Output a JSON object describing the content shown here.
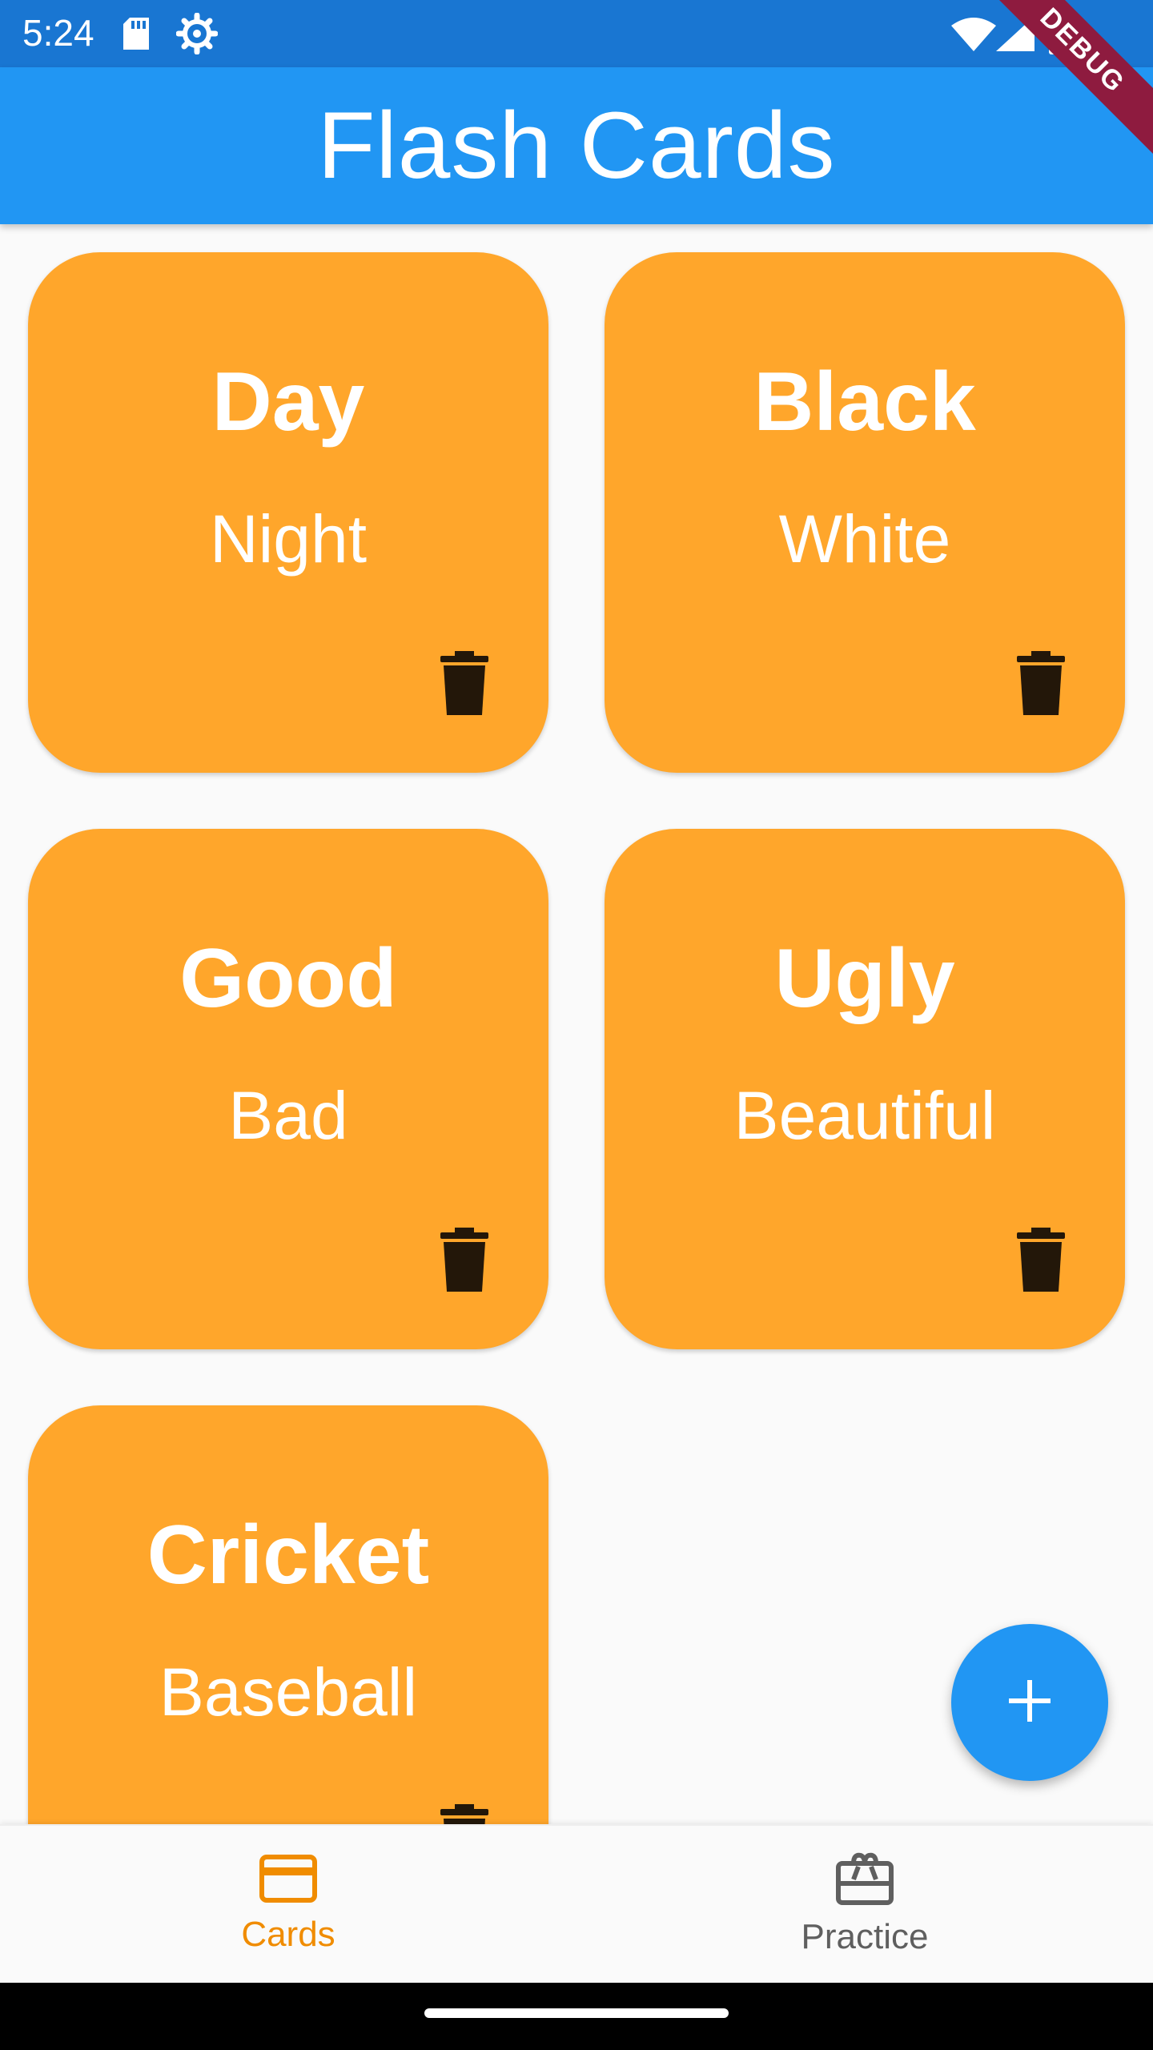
{
  "status_bar": {
    "time": "5:24",
    "icons": [
      "sd-card-icon",
      "settings-gear-icon",
      "wifi-icon",
      "signal-icon",
      "battery-icon"
    ]
  },
  "debug_banner": "DEBUG",
  "app_bar": {
    "title": "Flash Cards"
  },
  "cards": [
    {
      "front": "Day",
      "back": "Night"
    },
    {
      "front": "Black",
      "back": "White"
    },
    {
      "front": "Good",
      "back": "Bad"
    },
    {
      "front": "Ugly",
      "back": "Beautiful"
    },
    {
      "front": "Cricket",
      "back": "Baseball"
    }
  ],
  "fab": {
    "icon": "add-icon"
  },
  "bottom_nav": {
    "items": [
      {
        "label": "Cards",
        "icon": "credit-card-icon",
        "active": true
      },
      {
        "label": "Practice",
        "icon": "card-giftcard-icon",
        "active": false
      }
    ]
  },
  "colors": {
    "status_bar": "#1976d2",
    "app_bar": "#2196f3",
    "card": "#ffa62b",
    "active_nav": "#f08c00",
    "inactive_nav": "#5f5f5f",
    "fab": "#2196f3"
  }
}
